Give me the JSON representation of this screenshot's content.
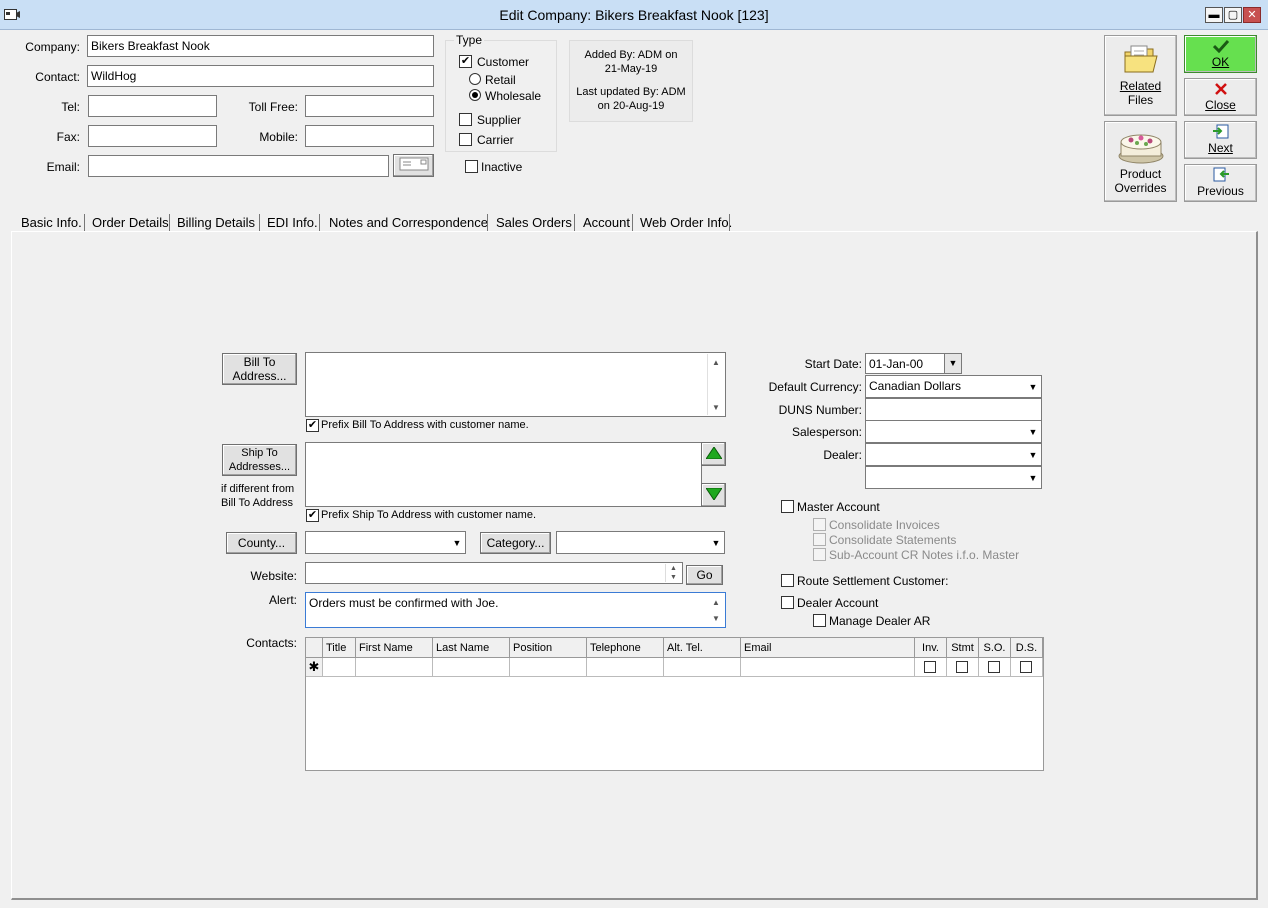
{
  "window": {
    "title": "Edit Company: Bikers Breakfast Nook [123]",
    "min": "▬",
    "max": "▢",
    "close": "✕"
  },
  "header": {
    "company_label": "Company:",
    "company_value": "Bikers Breakfast Nook",
    "contact_label": "Contact:",
    "contact_value": "WildHog",
    "tel_label": "Tel:",
    "tel_value": "",
    "tollfree_label": "Toll Free:",
    "tollfree_value": "",
    "fax_label": "Fax:",
    "fax_value": "",
    "mobile_label": "Mobile:",
    "mobile_value": "",
    "email_label": "Email:",
    "email_value": ""
  },
  "type": {
    "legend": "Type",
    "customer": "Customer",
    "customer_checked": true,
    "retail": "Retail",
    "wholesale": "Wholesale",
    "wholesale_selected": true,
    "supplier": "Supplier",
    "carrier": "Carrier",
    "inactive": "Inactive"
  },
  "audit": {
    "added_line1": "Added By: ADM on",
    "added_line2": "21-May-19",
    "updated_line1": "Last updated By: ADM",
    "updated_line2": "on 20-Aug-19"
  },
  "actions": {
    "related_files_line1": "Related",
    "related_files_line2": "Files",
    "product_overrides_line1": "Product",
    "product_overrides_line2": "Overrides",
    "ok": "OK",
    "close": "Close",
    "next": "Next",
    "previous": "Previous"
  },
  "tabs": [
    {
      "label": "Basic Info."
    },
    {
      "label": "Order Details"
    },
    {
      "label": "Billing Details"
    },
    {
      "label": "EDI Info."
    },
    {
      "label": "Notes and Correspondence"
    },
    {
      "label": "Sales Orders"
    },
    {
      "label": "Account"
    },
    {
      "label": "Web Order Info."
    }
  ],
  "basic": {
    "bill_to_btn_line1": "Bill To",
    "bill_to_btn_line2": "Address...",
    "bill_to_address": "",
    "prefix_bill": "Prefix Bill To Address with customer name.",
    "ship_to_btn_line1": "Ship To",
    "ship_to_btn_line2": "Addresses...",
    "ship_note_line1": "if different from",
    "ship_note_line2": "Bill To Address",
    "ship_to_address": "",
    "prefix_ship": "Prefix Ship To Address with customer name.",
    "county_btn": "County...",
    "county_value": "",
    "category_btn": "Category...",
    "category_value": "",
    "website_label": "Website:",
    "website_value": "",
    "go_btn": "Go",
    "alert_label": "Alert:",
    "alert_value": "Orders must be confirmed with Joe.",
    "contacts_label": "Contacts:",
    "start_date_label": "Start Date:",
    "start_date_value": "01-Jan-00",
    "currency_label": "Default Currency:",
    "currency_value": "Canadian Dollars",
    "duns_label": "DUNS Number:",
    "duns_value": "",
    "salesperson_label": "Salesperson:",
    "salesperson_value": "",
    "dealer_label": "Dealer:",
    "dealer_value": "",
    "extra_value": "",
    "master_account": "Master Account",
    "consolidate_invoices": "Consolidate Invoices",
    "consolidate_statements": "Consolidate Statements",
    "sub_account_notes": "Sub-Account CR Notes i.f.o. Master",
    "route_settlement": "Route Settlement Customer:",
    "dealer_account": "Dealer Account",
    "manage_dealer_ar": "Manage Dealer AR"
  },
  "contacts_grid": {
    "new_row_marker": "✱",
    "columns": [
      "Title",
      "First Name",
      "Last Name",
      "Position",
      "Telephone",
      "Alt. Tel.",
      "Email",
      "Inv.",
      "Stmt",
      "S.O.",
      "D.S."
    ]
  }
}
